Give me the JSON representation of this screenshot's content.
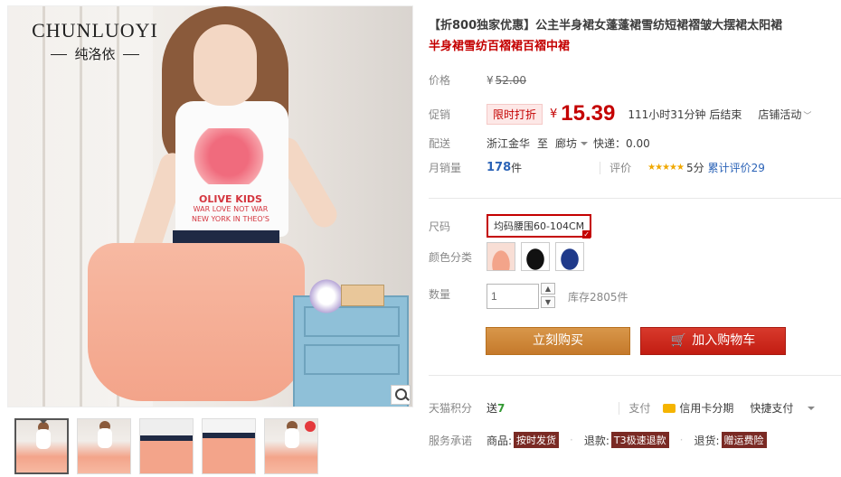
{
  "gallery": {
    "brand_en": "CHUNLUOYI",
    "brand_cn": "纯洛依",
    "shirt_text": [
      "OLIVE KIDS",
      "WAR LOVE NOT WAR",
      "NEW YORK IN THEO'S"
    ],
    "thumbnails": [
      "thumb-1",
      "thumb-2",
      "thumb-3",
      "thumb-4",
      "thumb-5"
    ]
  },
  "product": {
    "title_highlight": "【折800独家优惠】",
    "title_rest": "公主半身裙女蓬蓬裙雪纺短裙褶皱大摆裙太阳裙",
    "title_line2": "半身裙雪纺百褶裙百褶中裙"
  },
  "price": {
    "label": "价格",
    "currency": "¥",
    "original": "52.00"
  },
  "promo": {
    "label": "促销",
    "tag": "限时打折",
    "currency": "¥",
    "price": "15.39",
    "countdown": "111小时31分钟 后结束",
    "shop_activity": "店铺活动"
  },
  "delivery": {
    "label": "配送",
    "from": "浙江金华",
    "to_word": "至",
    "to": "廊坊",
    "express": "快递：0.00"
  },
  "sales": {
    "label": "月销量",
    "count": "178",
    "unit": "件",
    "rating_label": "评价",
    "stars": "★★★★★",
    "score": "5分",
    "review_link": "累计评价29"
  },
  "options": {
    "size_label": "尺码",
    "size_value": "均码腰围60-104CM",
    "color_label": "颜色分类",
    "colors": [
      "粉色",
      "黑色",
      "蓝色"
    ],
    "qty_label": "数量",
    "qty_value": "1",
    "stock": "库存2805件"
  },
  "actions": {
    "buy_now": "立刻购买",
    "add_cart": "加入购物车"
  },
  "extras": {
    "points_label": "天猫积分",
    "points_prefix": "送",
    "points_value": "7",
    "pay_label": "支付",
    "pay_card": "信用卡分期",
    "pay_quick": "快捷支付",
    "service_label": "服务承诺",
    "svc_goods": "商品:",
    "svc_goods_tag": "按时发货",
    "svc_refund": "退款:",
    "svc_refund_tag": "T3极速退款",
    "svc_return": "退货:",
    "svc_return_tag": "赠运费险"
  },
  "colors": {
    "accent": "#c40000",
    "buy": "#d0873b",
    "cart": "#cc2a1d",
    "link": "#2b63b7"
  }
}
